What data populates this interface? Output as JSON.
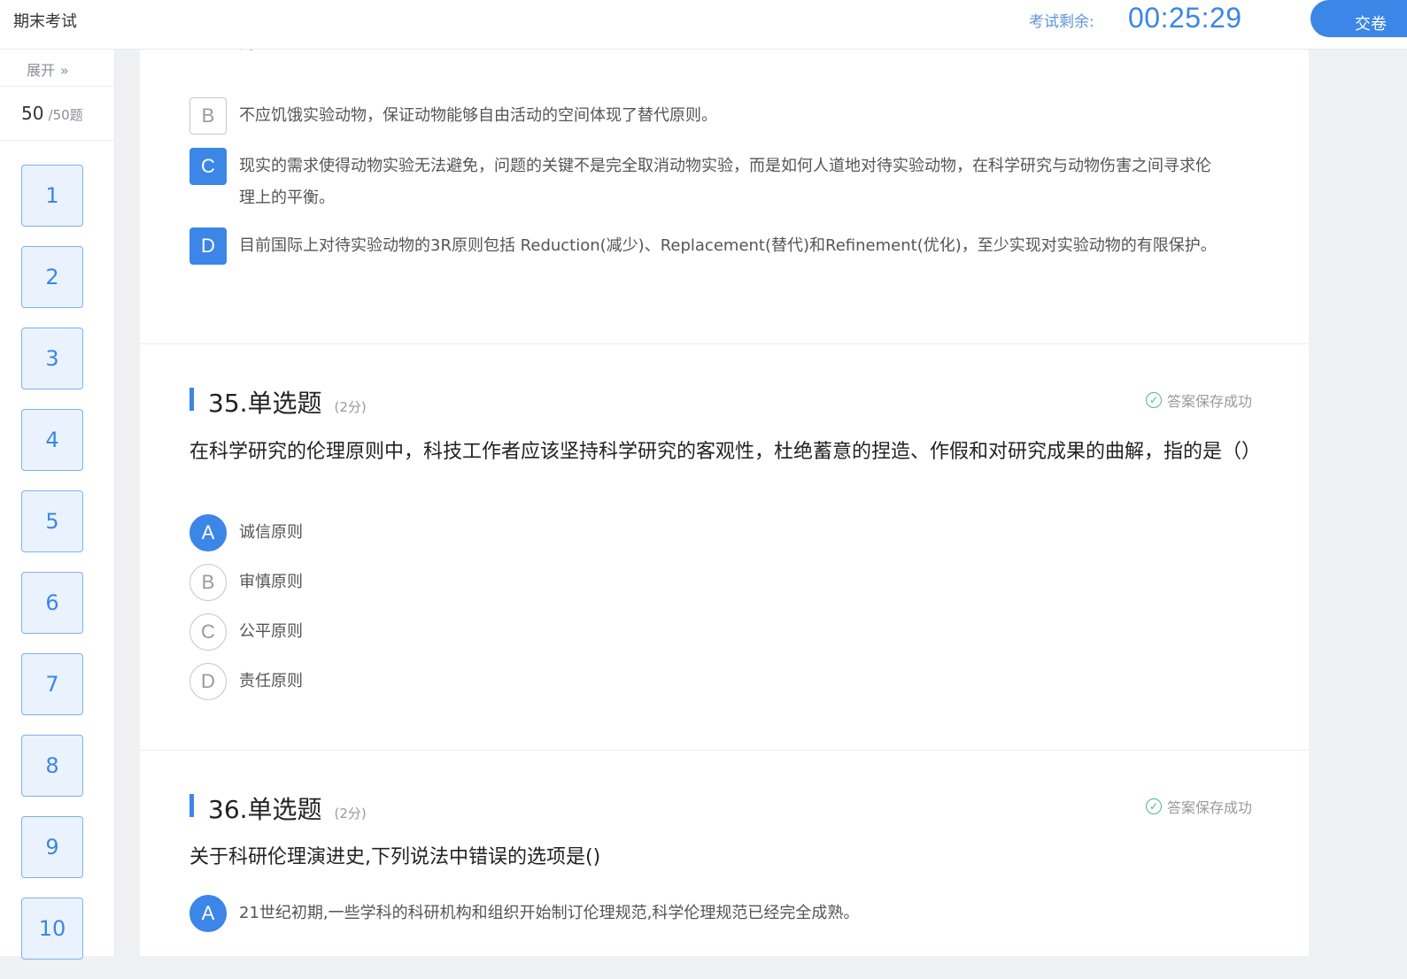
{
  "header": {
    "exam_title": "期末考试",
    "timer_label": "考试剩余:",
    "timer_value": "00:25:29",
    "submit_label": "交卷"
  },
  "sidebar": {
    "expand_label": "展开",
    "expand_icon": "»",
    "answered_count": "50",
    "total_label": "/50题",
    "question_numbers": [
      "1",
      "2",
      "3",
      "4",
      "5",
      "6",
      "7",
      "8",
      "9",
      "10"
    ]
  },
  "prev_question": {
    "option_a_tail": "则。",
    "options": [
      {
        "letter": "B",
        "text": "不应饥饿实验动物，保证动物能够自由活动的空间体现了替代原则。",
        "selected": false
      },
      {
        "letter": "C",
        "text": "现实的需求使得动物实验无法避免，问题的关键不是完全取消动物实验，而是如何人道地对待实验动物，在科学研究与动物伤害之间寻求伦理上的平衡。",
        "selected": true
      },
      {
        "letter": "D",
        "text": "目前国际上对待实验动物的3R原则包括 Reduction(减少)、Replacement(替代)和Refinement(优化)，至少实现对实验动物的有限保护。",
        "selected": true
      }
    ]
  },
  "q35": {
    "title": "35.单选题",
    "score": "(2分)",
    "saved_label": "答案保存成功",
    "stem": "在科学研究的伦理原则中，科技工作者应该坚持科学研究的客观性，杜绝蓄意的捏造、作假和对研究成果的曲解，指的是（）",
    "options": [
      {
        "letter": "A",
        "text": "诚信原则",
        "selected": true
      },
      {
        "letter": "B",
        "text": "审慎原则",
        "selected": false
      },
      {
        "letter": "C",
        "text": "公平原则",
        "selected": false
      },
      {
        "letter": "D",
        "text": "责任原则",
        "selected": false
      }
    ]
  },
  "q36": {
    "title": "36.单选题",
    "score": "(2分)",
    "saved_label": "答案保存成功",
    "stem": "关于科研伦理演进史,下列说法中错误的选项是()",
    "options": [
      {
        "letter": "A",
        "text": "21世纪初期,一些学科的科研机构和组织开始制订伦理规范,科学伦理规范已经完全成熟。",
        "selected": true
      }
    ]
  },
  "colors": {
    "accent": "#3b86e6",
    "success": "#4cb97a"
  }
}
